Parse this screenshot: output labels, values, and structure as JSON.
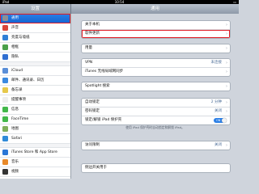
{
  "statusbar": {
    "carrier": "iPad",
    "time": "10:54",
    "battery": "▭"
  },
  "sidebar": {
    "title": "设置",
    "items": [
      {
        "label": "通用",
        "icon": "gear-icon",
        "color": "#8e8e93",
        "selected": true
      },
      {
        "label": "声音",
        "icon": "speaker-icon",
        "color": "#d9453a"
      },
      {
        "label": "亮度与墙纸",
        "icon": "sun-icon",
        "color": "#2f7fd6"
      },
      {
        "label": "相框",
        "icon": "picture-frame-icon",
        "color": "#4aa04a"
      },
      {
        "label": "隐私",
        "icon": "hand-icon",
        "color": "#2f6fd1"
      },
      {
        "label": "iCloud",
        "icon": "cloud-icon",
        "color": "#5a8ed8"
      },
      {
        "label": "邮件、通讯录、日历",
        "icon": "mail-icon",
        "color": "#3a89e0"
      },
      {
        "label": "备忘录",
        "icon": "notes-icon",
        "color": "#e6c84a"
      },
      {
        "label": "提醒事项",
        "icon": "checklist-icon",
        "color": "#eeeeee"
      },
      {
        "label": "信息",
        "icon": "message-icon",
        "color": "#43b84a"
      },
      {
        "label": "FaceTime",
        "icon": "video-icon",
        "color": "#43b84a"
      },
      {
        "label": "地图",
        "icon": "map-icon",
        "color": "#7fae5a"
      },
      {
        "label": "Safari",
        "icon": "compass-icon",
        "color": "#2f8ad8"
      },
      {
        "label": "iTunes Store 和 App Store",
        "icon": "app-store-icon",
        "color": "#2b77d6"
      },
      {
        "label": "音乐",
        "icon": "music-icon",
        "color": "#e8892a"
      },
      {
        "label": "视频",
        "icon": "video-icon",
        "color": "#333333"
      }
    ]
  },
  "main": {
    "title": "通用",
    "groups": [
      {
        "rows": [
          {
            "label": "关于本机"
          },
          {
            "label": "软件更新",
            "highlight": true
          }
        ]
      },
      {
        "rows": [
          {
            "label": "用量"
          }
        ]
      },
      {
        "rows": [
          {
            "label": "VPN",
            "value": "未连接"
          },
          {
            "label": "iTunes 无线局域网同步"
          }
        ]
      },
      {
        "rows": [
          {
            "label": "Spotlight 搜索"
          }
        ]
      },
      {
        "rows": [
          {
            "label": "自动锁定",
            "value": "2 分钟"
          },
          {
            "label": "密码锁定",
            "value": "关闭"
          },
          {
            "label": "锁定/解锁 iPad 保护壳",
            "toggle": "ON"
          }
        ]
      },
      {
        "rows": [
          {
            "label": "访问限制",
            "value": "关闭"
          }
        ]
      },
      {
        "rows": [
          {
            "label": "侧边开关用于"
          }
        ]
      }
    ],
    "note": "使用 iPad 保护壳时自动锁定和解锁 iPad。"
  }
}
